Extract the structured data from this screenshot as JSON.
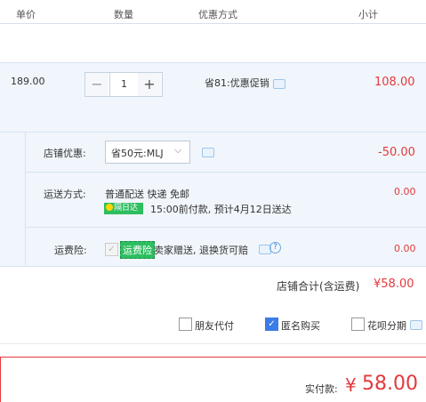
{
  "header": {
    "col_price": "单价",
    "col_quantity": "数量",
    "col_promo": "优惠方式",
    "col_subtotal": "小计"
  },
  "item": {
    "unit_price": "189.00",
    "quantity": "1",
    "minus": "−",
    "plus": "+",
    "promo": "省81:优惠促销",
    "subtotal": "108.00"
  },
  "shop": {
    "discount_label": "店铺优惠:",
    "discount_value": "省50元:MLJ",
    "discount_amount": "-50.00",
    "shipping_label": "运送方式:",
    "shipping_method": "普通配送 快递 免邮",
    "sameday_badge": "隔日达",
    "delivery_note": "15:00前付款, 预计4月12日送达",
    "shipping_fee": "0.00",
    "insurance_label": "运费险:",
    "insurance_badge": "运费险",
    "insurance_note": "卖家赠送, 退换货可赔",
    "insurance_fee": "0.00",
    "total_label": "店铺合计(含运费)",
    "total_value": "¥58.00"
  },
  "options": {
    "friend_pay": "朋友代付",
    "anonymous": "匿名购买",
    "huabei": "花呗分期"
  },
  "payment": {
    "label": "实付款:",
    "currency": "¥",
    "amount": "58.00"
  },
  "colors": {
    "price_red": "#e4393c",
    "panel_bg": "#f1f6fc",
    "border_blue": "#d6e3f0",
    "badge_green": "#2dbe60",
    "check_blue": "#3b7de6"
  }
}
